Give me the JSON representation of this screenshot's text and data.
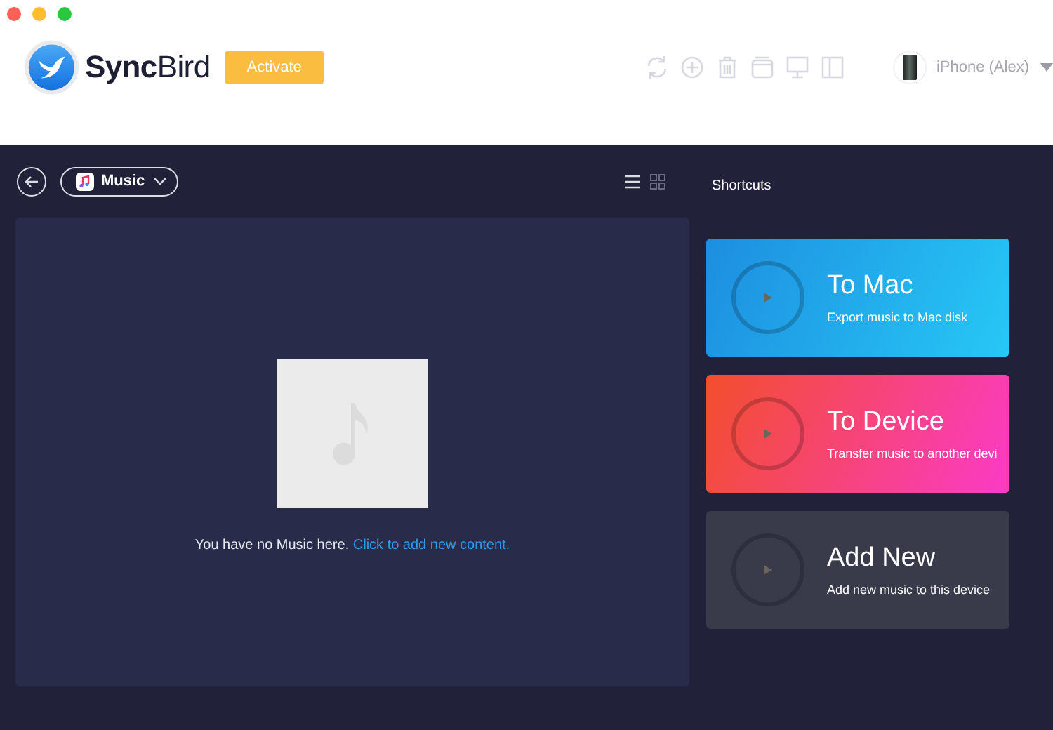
{
  "window": {
    "controls": [
      {
        "color": "#fe5f57"
      },
      {
        "color": "#febc2e"
      },
      {
        "color": "#28c840"
      }
    ]
  },
  "header": {
    "app_name": "**Sync**Bird",
    "activate_button": "Activate",
    "toolbar": [
      {
        "kind": "sync"
      },
      {
        "kind": "add"
      },
      {
        "kind": "trash"
      },
      {
        "kind": "box"
      },
      {
        "kind": "monitor"
      },
      {
        "kind": "panel"
      }
    ],
    "device": {
      "name": "iPhone (Alex)"
    }
  },
  "library": {
    "category": "Music",
    "view_modes": [
      {
        "kind": "list",
        "selected": true
      },
      {
        "kind": "grid",
        "selected": false
      }
    ],
    "empty_state": {
      "message": "You have no Music here.",
      "link": "Click to add new content."
    }
  },
  "shortcuts": {
    "title": "Shortcuts",
    "items": [
      {
        "kind": "export",
        "title": "To Mac",
        "subtitle": "Export music to Mac disk"
      },
      {
        "kind": "transfer",
        "title": "To Device",
        "subtitle": "Transfer music to another devi"
      },
      {
        "kind": "add",
        "title": "Add New",
        "subtitle": "Add new music to this device"
      }
    ]
  }
}
